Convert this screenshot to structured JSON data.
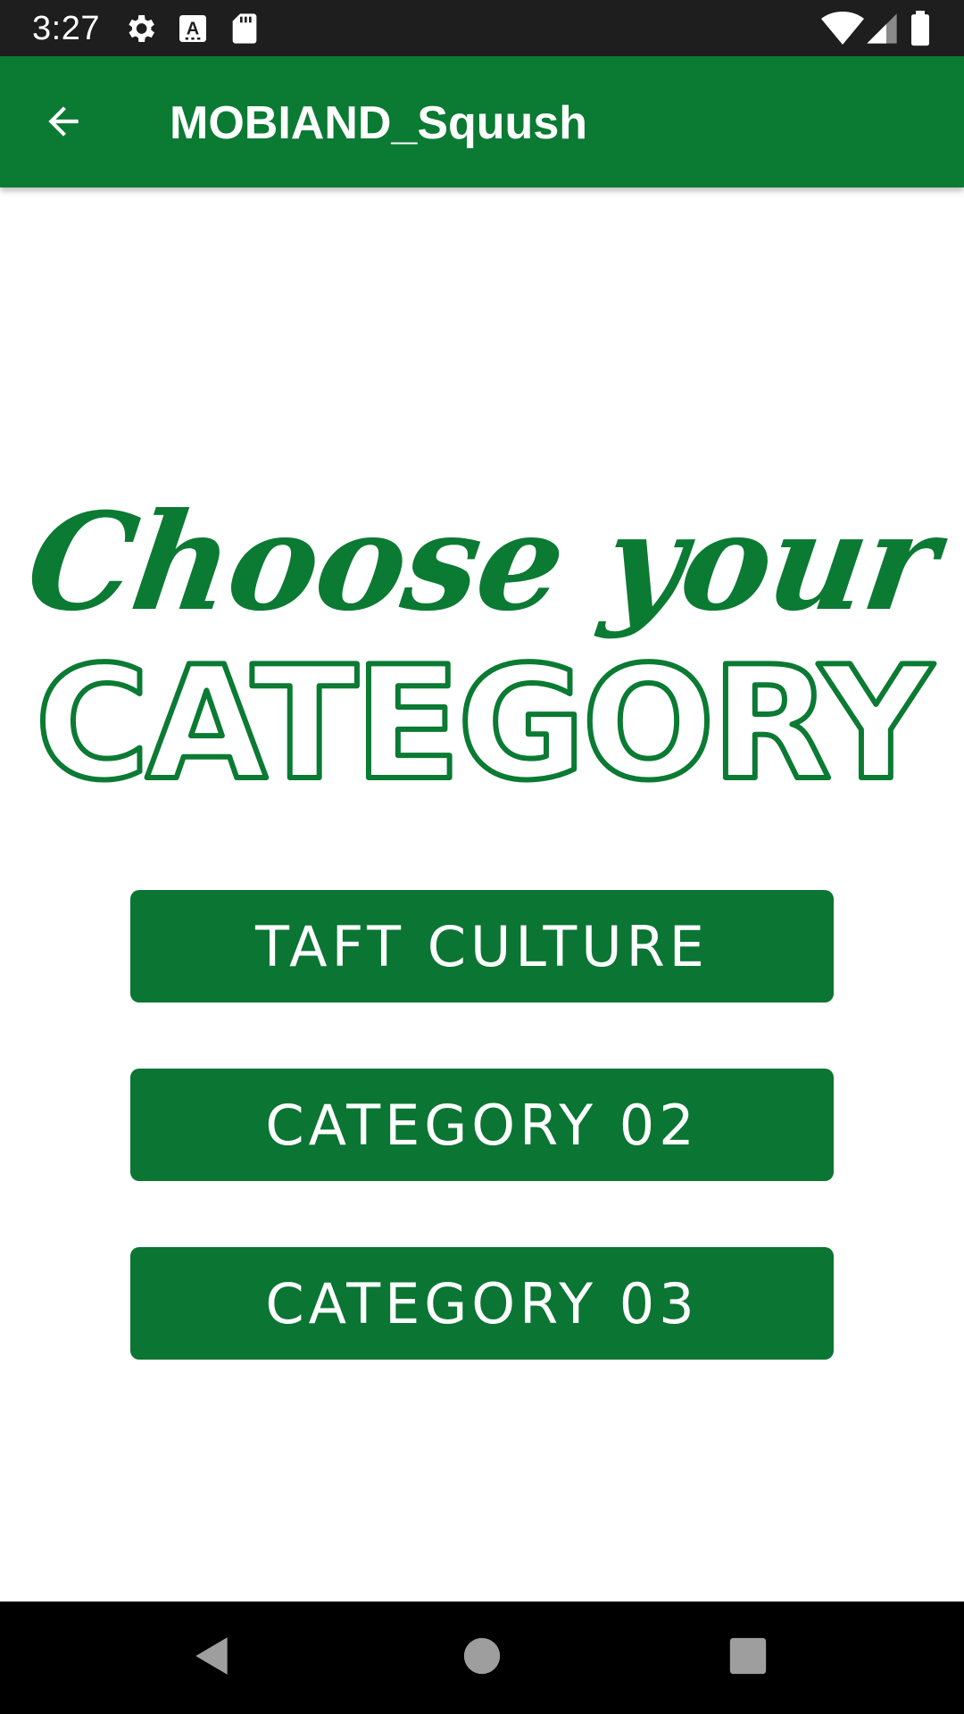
{
  "status_bar": {
    "time": "3:27",
    "icons_left": [
      "gear-icon",
      "a-keyboard-icon",
      "sd-card-icon"
    ],
    "icons_right": [
      "wifi-icon",
      "signal-icon",
      "battery-icon"
    ]
  },
  "app_bar": {
    "title": "MOBIAND_Squush",
    "back_icon": "arrow-back-icon",
    "color": "#0b7a33"
  },
  "heading": {
    "line1": "Choose your",
    "line2": "CATEGORY",
    "color": "#0b7a33"
  },
  "categories": [
    {
      "label": "TAFT CULTURE"
    },
    {
      "label": "CATEGORY 02"
    },
    {
      "label": "CATEGORY 03"
    }
  ],
  "button_color": "#0b7533",
  "nav_bar": {
    "buttons": [
      "back-triangle-icon",
      "home-circle-icon",
      "recents-square-icon"
    ]
  }
}
